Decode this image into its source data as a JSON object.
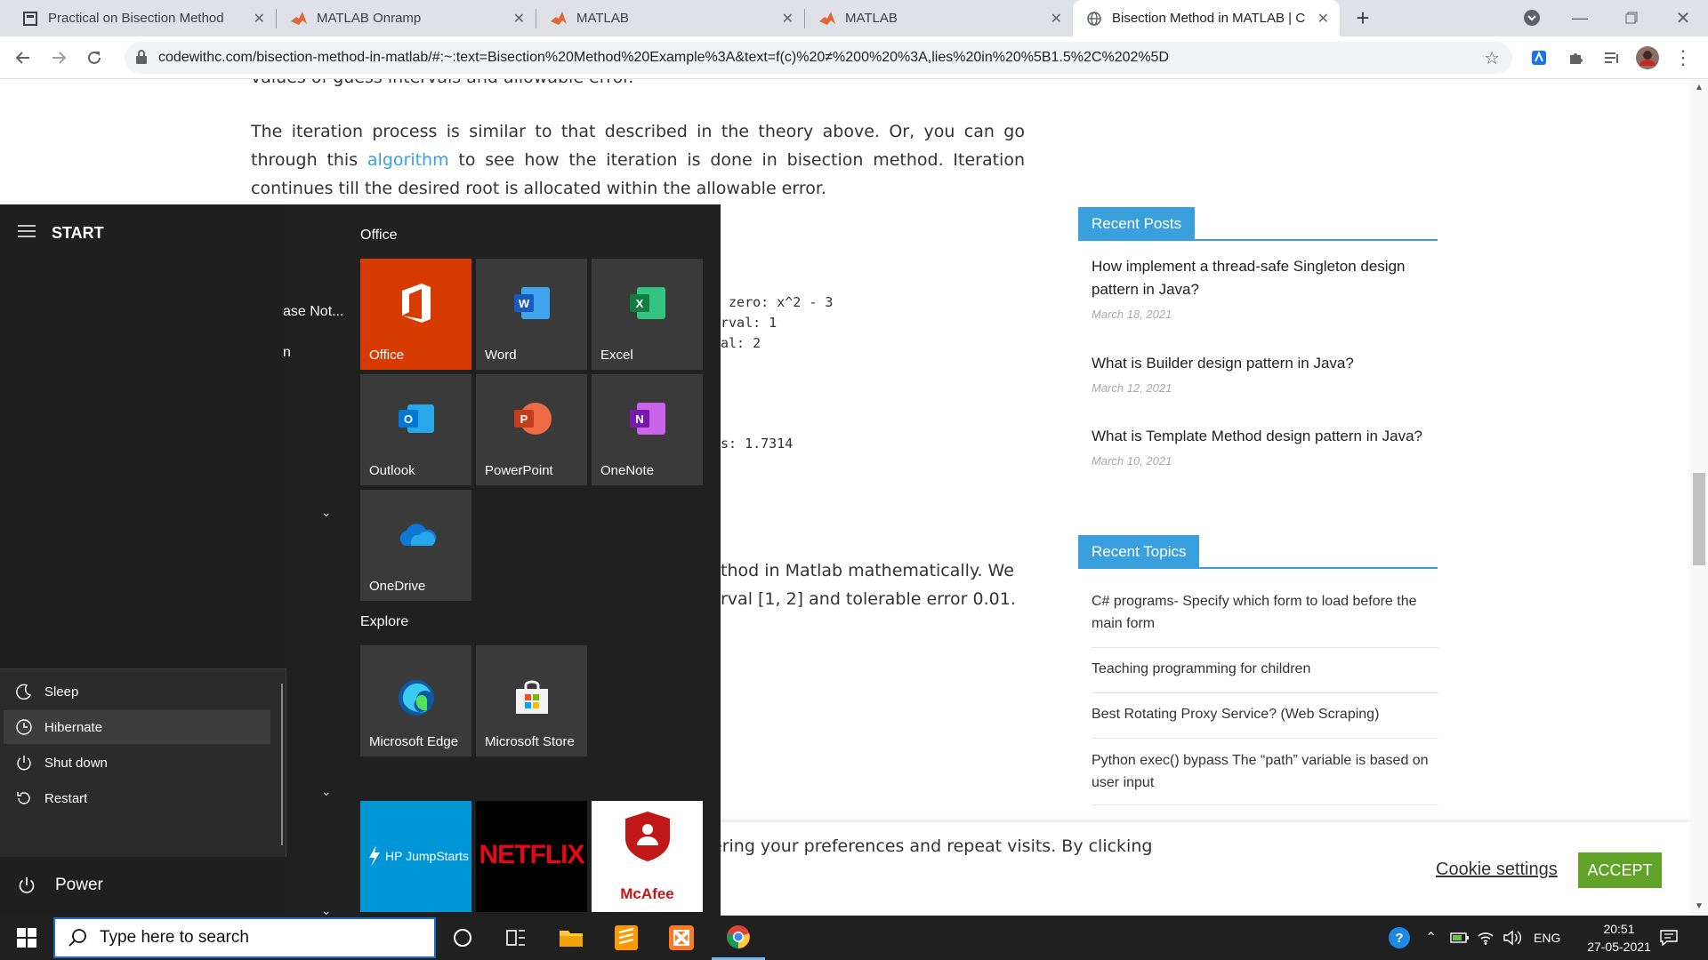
{
  "browser": {
    "tabs": [
      {
        "title": "Practical on Bisection Method",
        "icon": "document-icon"
      },
      {
        "title": "MATLAB Onramp",
        "icon": "matlab-icon"
      },
      {
        "title": "MATLAB",
        "icon": "matlab-icon"
      },
      {
        "title": "MATLAB",
        "icon": "matlab-icon"
      },
      {
        "title": "Bisection Method in MATLAB | C",
        "icon": "globe-icon"
      }
    ],
    "url": "codewithc.com/bisection-method-in-matlab/#:~:text=Bisection%20Method%20Example%3A&text=f(c)%20≠%200%20%3A,lies%20in%20%5B1.5%2C%202%5D"
  },
  "article": {
    "line_top": "values of guess intervals and allowable error.",
    "para1_a": "The iteration process is similar to that described in the theory above. Or, you can go through this ",
    "para1_link": "algorithm",
    "para1_b": " to see how the iteration is done in bisection method. Iteration continues till the desired root is allocated within the allowable error.",
    "code_lines": [
      " zero: x^2 - 3",
      "rval: 1",
      "al: 2"
    ],
    "code_result": "s: 1.7314",
    "para2_line1": "thod in Matlab mathematically. We",
    "para2_line2": "rval [1, 2] and tolerable error 0.01."
  },
  "sidebar": {
    "recent_posts_title": "Recent Posts",
    "recent_posts": [
      {
        "title": "How implement a thread-safe Singleton design pattern in Java?",
        "date": "March 18, 2021"
      },
      {
        "title": "What is Builder design pattern in Java?",
        "date": "March 12, 2021"
      },
      {
        "title": "What is Template Method design pattern in Java?",
        "date": "March 10, 2021"
      }
    ],
    "recent_topics_title": "Recent Topics",
    "recent_topics": [
      "C# programs- Specify which form to load before the main form",
      "Teaching programming for children",
      "Best Rotating Proxy Service? (Web Scraping)",
      "Python exec() bypass The “path” variable is based on user input"
    ]
  },
  "cookie": {
    "text": "ering your preferences and repeat visits. By clicking",
    "settings": "Cookie settings",
    "accept": "ACCEPT"
  },
  "start_menu": {
    "title": "START",
    "partial_item_1": "ase Not...",
    "partial_item_2": "n",
    "group_office": "Office",
    "group_explore": "Explore",
    "tiles_office": [
      {
        "label": "Office",
        "icon": "office-icon",
        "bg": "#d83b01"
      },
      {
        "label": "Word",
        "icon": "word-icon",
        "bg": "#3a3a3a"
      },
      {
        "label": "Excel",
        "icon": "excel-icon",
        "bg": "#3a3a3a"
      },
      {
        "label": "Outlook",
        "icon": "outlook-icon",
        "bg": "#3a3a3a"
      },
      {
        "label": "PowerPoint",
        "icon": "powerpoint-icon",
        "bg": "#3a3a3a"
      },
      {
        "label": "OneNote",
        "icon": "onenote-icon",
        "bg": "#3a3a3a"
      },
      {
        "label": "OneDrive",
        "icon": "onedrive-icon",
        "bg": "#3a3a3a"
      }
    ],
    "tiles_explore": [
      {
        "label": "Microsoft Edge",
        "icon": "edge-icon"
      },
      {
        "label": "Microsoft Store",
        "icon": "store-icon"
      }
    ],
    "tiles_bottom": [
      {
        "label": "HP JumpStarts",
        "icon": "hp-jumpstarts-icon",
        "bg": "#0096d6"
      },
      {
        "label": "NETFLIX",
        "icon": "netflix-icon",
        "bg": "#000000"
      },
      {
        "label": "McAfee",
        "icon": "mcafee-icon",
        "bg": "#ffffff"
      }
    ],
    "power_options": [
      "Sleep",
      "Hibernate",
      "Shut down",
      "Restart"
    ],
    "power_label": "Power"
  },
  "taskbar": {
    "search_placeholder": "Type here to search",
    "language": "ENG",
    "time": "20:51",
    "date": "27-05-2021"
  }
}
